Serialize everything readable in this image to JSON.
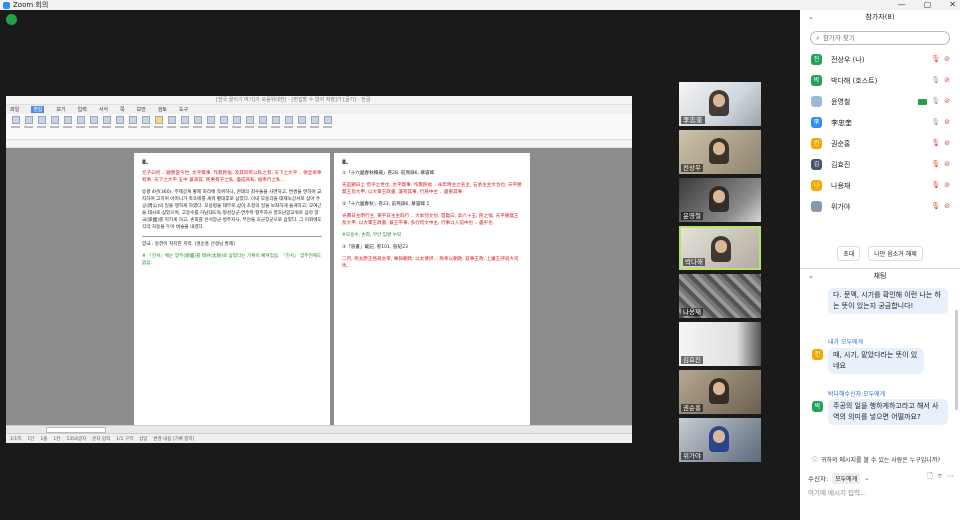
{
  "window": {
    "title": "Zoom 회의",
    "minimize": "—",
    "maximize": "▢",
    "close": "✕"
  },
  "colors": {
    "accent": "#2d8cff",
    "muted": "#e0463a",
    "active_border": "#b6e36a"
  },
  "shared_screen": {
    "app_title": "[한국 끝이기 여기]가 모음위대한] - [편집할 수 없어 저장]가 [글기] - 한글",
    "menu": [
      "파일",
      "편집",
      "보기",
      "입력",
      "서식",
      "쪽",
      "보안",
      "검토",
      "도구"
    ],
    "page1": {
      "heading": "Ⅱ.",
      "para1": "元子曰何... 顧我當今世, 太平無事, 作無民福, 及其同有公私之有, 天下之大平 .. 保全承奉有奉, 天下之大平 五中 兼承其, 民惠有子之私, 盡成爲私, 福奉行之私...",
      "para2": "승평 4년(360). 주제상계 황제 자리에 즉위하니, 천태의 최수둘을 사면하고, 변경을 면하며 교지하며 고치며 어머니가 축호에를 세워 황대후로 삼았다. 이내 모용각을 태재녹상서로 삼아 주공(周公)의 일을 행하게 하였다. 모용평을 태부로 삼아 조정의 일을 보좌하게 들게하고, 모여근을 태사로 삼았으며, 고중수를 하남대도독·형성장군·연주목·형주자사 영호남양교위로 삼아 양국(梁國)를 지키게 하고, 손희를 안서장군·병주자사, 부안을 호군장군으로 삼았다. 그 이외에도 각각 차등을 두어 벼슬을 내렸다.",
      "para3": "양국 : 동한이 처치한 지역. (권순홍 선생님 발제)",
      "para4": "# 『진서』에는 양주(梁國)를 태위(太尉)로 삼았다는 기록이 빠져있음. 『진서』 양주전에도 없음."
    },
    "page2": {
      "heading": "Ⅱ.",
      "note1": "①「十六國春秋輯補」卷28, 前燕錄6, 慕容暐",
      "para1": "先是顧日上 惜乎之世也, 太平無事, 作無民福 .. 永年時主之名主, 石承主主文治也, 天平勝無王及大甲, 以大軍王政書, 兼有其事, 行爲中主 .. 盡重其事",
      "note2": "②「十六國春秋」卷23, 前燕錄6, 慕容暐 1",
      "para2": "光壽日主明行主, 東平日主主四行 .. 大本何文也, 首義曰, 高六十五, 民之福, 天平勝無王及大甲, 以大軍王政書, 兼王平事, 多行何文中主, 行事以入前中也 .. 盡乎也.",
      "note3": "#모용수, 손희, 부안 임명 누락",
      "note4": "③「晉書」載記, 卷101, 晉紀23",
      "para3": "二月, 燕太原王恪爲太宰, 專錄朝政, 以太傅評... 燕奉以朝政, 寫事王政, 上庸王評爲大司馬..."
    },
    "status": [
      "1/1쪽",
      "1단",
      "1줄",
      "1칸",
      "1354글자",
      "문자 입력",
      "1/1 구역",
      "삽입",
      "변경 내용 [기록 중지]"
    ]
  },
  "videos": [
    {
      "name": "李忠奎"
    },
    {
      "name": "전상우"
    },
    {
      "name": "윤영철"
    },
    {
      "name": "박다해"
    },
    {
      "name": "나용재"
    },
    {
      "name": "김효진"
    },
    {
      "name": "권순홍"
    },
    {
      "name": "위가야"
    }
  ],
  "participants": {
    "header": "참가자(8)",
    "search_placeholder": "참가자 찾기",
    "list": [
      {
        "avatar": "전",
        "color": "#22a35c",
        "name": "전상우 (나)"
      },
      {
        "avatar": "박",
        "color": "#22a35c",
        "name": "박다해 (호스트)"
      },
      {
        "avatar": "",
        "color": "#a0b8d8",
        "name": "윤영철"
      },
      {
        "avatar": "李",
        "color": "#2d8cff",
        "name": "李忠奎"
      },
      {
        "avatar": "권",
        "color": "#f2a900",
        "name": "권순홍"
      },
      {
        "avatar": "김",
        "color": "#4a5566",
        "name": "김효진"
      },
      {
        "avatar": "나",
        "color": "#f2a900",
        "name": "나용재"
      },
      {
        "avatar": "",
        "color": "#8899aa",
        "name": "위가야"
      }
    ],
    "invite_label": "초대",
    "unmute_all_label": "나만 음소거 해제"
  },
  "chat": {
    "header": "채팅",
    "bubble1": "다. 문맥, 시기를 확인해 이런 나는 하는 뜻이 있는지 궁금합니다!",
    "sender2": "내가 모두에게",
    "bubble2": "때, 시기, 맡았다라는 뜻이 있네요",
    "sender3": "박다해수신자:모두에게",
    "avatar3": "박",
    "bubble3": "주공의 일을 행하게하고라고 해서 사역의 의미를 넣으면 어떨까요?",
    "notice": "귀하의 메시지를 볼 수 있는 사람은 누구입니까?",
    "to_label": "수신자:",
    "to_value": "모두에게",
    "input_placeholder": "여기에 메시지 입력..."
  }
}
